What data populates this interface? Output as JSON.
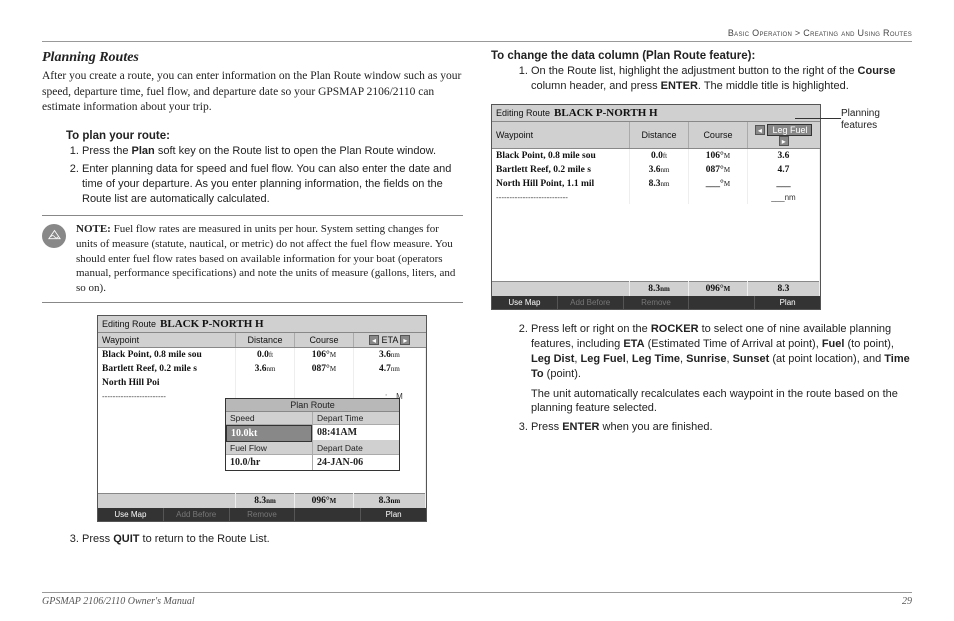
{
  "breadcrumb": {
    "section": "Basic Operation",
    "sep": " > ",
    "page": "Creating and Using Routes"
  },
  "left": {
    "title": "Planning Routes",
    "intro": "After you create a route, you can enter information on the Plan Route window such as your speed, departure time, fuel flow, and departure date so your GPSMAP 2106/2110 can estimate information about your trip.",
    "subhead": "To plan your route:",
    "step1_a": "Press the ",
    "step1_b": "Plan",
    "step1_c": " soft key on the Route list to open the Plan Route window.",
    "step2": "Enter planning data for speed and fuel flow. You can also enter the date and time of your departure. As you enter planning information, the fields on the Route list are automatically calculated.",
    "note_label": "NOTE:",
    "note_body": " Fuel flow rates are measured in units per hour. System setting changes for units of measure (statute, nautical, or metric) do not affect the fuel flow measure. You should enter fuel flow rates based on available information for your boat (operators manual, performance specifications) and note the units of measure (gallons, liters, and so on).",
    "step3_a": "Press ",
    "step3_b": "QUIT",
    "step3_c": " to return to the Route List."
  },
  "right": {
    "subhead": "To change the data column (Plan Route feature):",
    "step1_a": "On the Route list, highlight the adjustment button to the right of the ",
    "step1_b": "Course",
    "step1_c": " column header, and press ",
    "step1_d": "ENTER",
    "step1_e": ". The middle title is highlighted.",
    "callout": "Planning features",
    "step2_a": "Press left or right on the ",
    "step2_b": "ROCKER",
    "step2_c": " to select one of nine available planning features, including ",
    "f1": "ETA",
    "f1_desc": " (Estimated Time of Arrival at point), ",
    "f2": "Fuel",
    "f2_desc": " (to point), ",
    "f3": "Leg Dist",
    "c": ", ",
    "f4": "Leg Fuel",
    "f5": "Leg Time",
    "f6": "Sunrise",
    "f7": "Sunset",
    "f7_desc": " (at point location), and ",
    "f8": "Time To",
    "f8_desc": " (point).",
    "step2_cont": "The unit automatically recalculates each waypoint in the route based on the planning feature selected.",
    "step3_a": "Press ",
    "step3_b": "ENTER",
    "step3_c": " when you are finished."
  },
  "gps1": {
    "title_prefix": "Editing Route",
    "route_name": "BLACK P-NORTH H",
    "col_wp": "Waypoint",
    "col_dist": "Distance",
    "col_course": "Course",
    "col_eta": "ETA",
    "rows": [
      {
        "wp": "Black Point, 0.8 mile sou",
        "dist": "0.0",
        "dunit": "ft",
        "course": "106°",
        "cunit": "M",
        "eta": "3.6",
        "eunit": "nm"
      },
      {
        "wp": "Bartlett Reef, 0.2 mile s",
        "dist": "3.6",
        "dunit": "nm",
        "course": "087°",
        "cunit": "M",
        "eta": "4.7",
        "eunit": "nm"
      },
      {
        "wp": "North Hill Poi",
        "dist": "",
        "dunit": "",
        "course": "",
        "cunit": "",
        "eta": "",
        "eunit": ""
      }
    ],
    "dashes": "------------------------",
    "dash_eta": "__:__M",
    "totals": {
      "dist": "8.3",
      "dunit": "nm",
      "course": "096°",
      "cunit": "M",
      "eta": "8.3",
      "eunit": "nm"
    },
    "softkeys": {
      "k1": "Use Map",
      "k2": "Add Before",
      "k3": "Remove",
      "k4": "",
      "k5": "Plan"
    }
  },
  "popup": {
    "title": "Plan Route",
    "speed_label": "Speed",
    "speed_val": "10.0",
    "speed_unit": "kt",
    "time_label": "Depart Time",
    "time_val": "08:41",
    "time_unit": "AM",
    "fuel_label": "Fuel Flow",
    "fuel_val": "10.0",
    "fuel_unit": "/hr",
    "date_label": "Depart Date",
    "date_val": "24-JAN-06"
  },
  "gps2": {
    "title_prefix": "Editing Route",
    "route_name": "BLACK P-NORTH H",
    "col_wp": "Waypoint",
    "col_dist": "Distance",
    "col_course": "Course",
    "col_hl": "Leg Fuel",
    "rows": [
      {
        "wp": "Black Point, 0.8 mile sou",
        "dist": "0.0",
        "dunit": "ft",
        "course": "106°",
        "cunit": "M",
        "val": "3.6"
      },
      {
        "wp": "Bartlett Reef, 0.2 mile s",
        "dist": "3.6",
        "dunit": "nm",
        "course": "087°",
        "cunit": "M",
        "val": "4.7"
      },
      {
        "wp": "North Hill Point, 1.1 mil",
        "dist": "8.3",
        "dunit": "nm",
        "course": "___°",
        "cunit": "M",
        "val": "___"
      }
    ],
    "dashes": "---------------------------",
    "dash_val": "___nm",
    "totals": {
      "dist": "8.3",
      "dunit": "nm",
      "course": "096°",
      "cunit": "M",
      "val": "8.3"
    },
    "softkeys": {
      "k1": "Use Map",
      "k2": "Add Before",
      "k3": "Remove",
      "k4": "",
      "k5": "Plan"
    }
  },
  "footer": {
    "left": "GPSMAP 2106/2110 Owner's Manual",
    "right": "29"
  }
}
